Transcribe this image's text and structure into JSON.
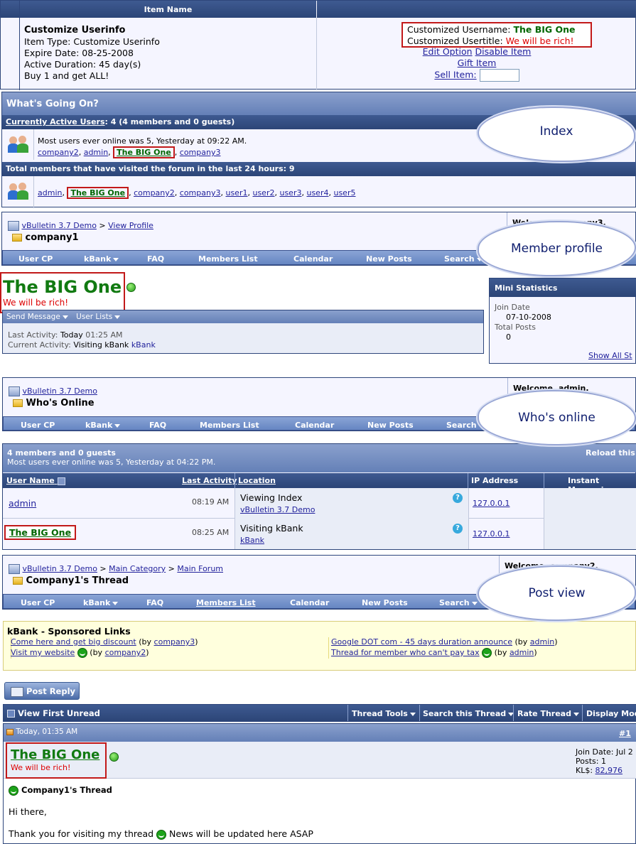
{
  "item_table": {
    "header": "Item Name",
    "name": "Customize Userinfo",
    "type": "Item Type: Customize Userinfo",
    "expire": "Expire Date: 08-25-2008",
    "duration": "Active Duration: 45 day(s)",
    "promo": "Buy 1 and get ALL!",
    "username_label": "Customized Username: ",
    "username_value": "The BIG One",
    "usertitle_label": "Customized Usertitle: ",
    "usertitle_value": "We will be rich!",
    "edit": "Edit Option",
    "disable": "Disable Item",
    "gift": "Gift Item",
    "sell": "Sell Item:"
  },
  "wgo": {
    "title": "What's Going On?",
    "active_link": "Currently Active Users",
    "active_rest": ": 4 (4 members and 0 guests)",
    "most_users": "Most users ever online was 5, Yesterday at 09:22 AM.",
    "users1": [
      "company2",
      "admin",
      "The BIG One",
      "company3"
    ],
    "visited": "Total members that have visited the forum in the last 24 hours: 9",
    "users2": [
      "admin",
      "The BIG One",
      "company2",
      "company3",
      "user1",
      "user2",
      "user3",
      "user4",
      "user5"
    ]
  },
  "clouds": {
    "index": "Index",
    "profile": "Member profile",
    "whos": "Who's online",
    "post": "Post view"
  },
  "nav_items": [
    "User CP",
    "kBank",
    "FAQ",
    "Members List",
    "Calendar",
    "New Posts",
    "Search"
  ],
  "profile": {
    "crumb_site": "vBulletin 3.7 Demo",
    "crumb_sep": ">",
    "crumb_view": "View Profile",
    "page_title": "company1",
    "welcome": "Welcome, company3.",
    "name": "The BIG One",
    "title": "We will be rich!",
    "send_msg": "Send Message",
    "user_lists": "User Lists",
    "last_activity": "Last Activity:",
    "last_activity_val": "Today",
    "last_activity_time": "01:25 AM",
    "current_activity": "Current Activity:",
    "current_activity_val": "Visiting kBank",
    "current_activity_link": "kBank",
    "mini_stats": "Mini Statistics",
    "join_label": "Join Date",
    "join_val": "07-10-2008",
    "posts_label": "Total Posts",
    "posts_val": "0",
    "show_all": "Show All St"
  },
  "whos": {
    "crumb_site": "vBulletin 3.7 Demo",
    "page_title": "Who's Online",
    "welcome": "Welcome, admin.",
    "summary": "4 members and 0 guests",
    "most": "Most users ever online was 5, Yesterday at 04:22 PM.",
    "reload": "Reload this",
    "col_user": "User Name",
    "col_activity": "Last Activity",
    "col_location": "Location",
    "col_ip": "IP Address",
    "col_im": "Instant Messagin",
    "rows": [
      {
        "user": "admin",
        "time": "08:19 AM",
        "loc": "Viewing Index",
        "loc_link": "vBulletin 3.7 Demo",
        "ip": "127.0.0.1"
      },
      {
        "user": "The BIG One",
        "time": "08:25 AM",
        "loc": "Visiting kBank",
        "loc_link": "kBank",
        "ip": "127.0.0.1"
      }
    ]
  },
  "post": {
    "crumb_site": "vBulletin 3.7 Demo",
    "crumb_cat": "Main Category",
    "crumb_forum": "Main Forum",
    "page_title": "Company1's Thread",
    "welcome": "Welcome, company2.",
    "sponsored_title": "kBank - Sponsored Links",
    "links_left": [
      {
        "text": "Come here and get big discount",
        "by": "company3"
      },
      {
        "text": "Visit my website",
        "by": "company2"
      }
    ],
    "links_right": [
      {
        "text": "Google DOT com - 45 days duration announce",
        "by": "admin"
      },
      {
        "text": "Thread for member who can't pay tax",
        "by": "admin"
      }
    ],
    "by_word": "(by",
    "post_reply": "Post Reply",
    "view_first": "View First Unread",
    "thread_tools": "Thread Tools",
    "search_thread": "Search this Thread",
    "rate_thread": "Rate Thread",
    "display_modes": "Display Mode",
    "post_date": "Today, 01:35 AM",
    "post_num": "#1",
    "poster": "The BIG One",
    "poster_title": "We will be rich!",
    "join_date": "Join Date: Jul 2",
    "posts": "Posts: 1",
    "kl_label": "KL$: ",
    "kl_val": "82,976",
    "post_title": "Company1's Thread",
    "msg1": "Hi there,",
    "msg2a": "Thank you for visiting my thread",
    "msg2b": "News will be updated here ASAP"
  }
}
